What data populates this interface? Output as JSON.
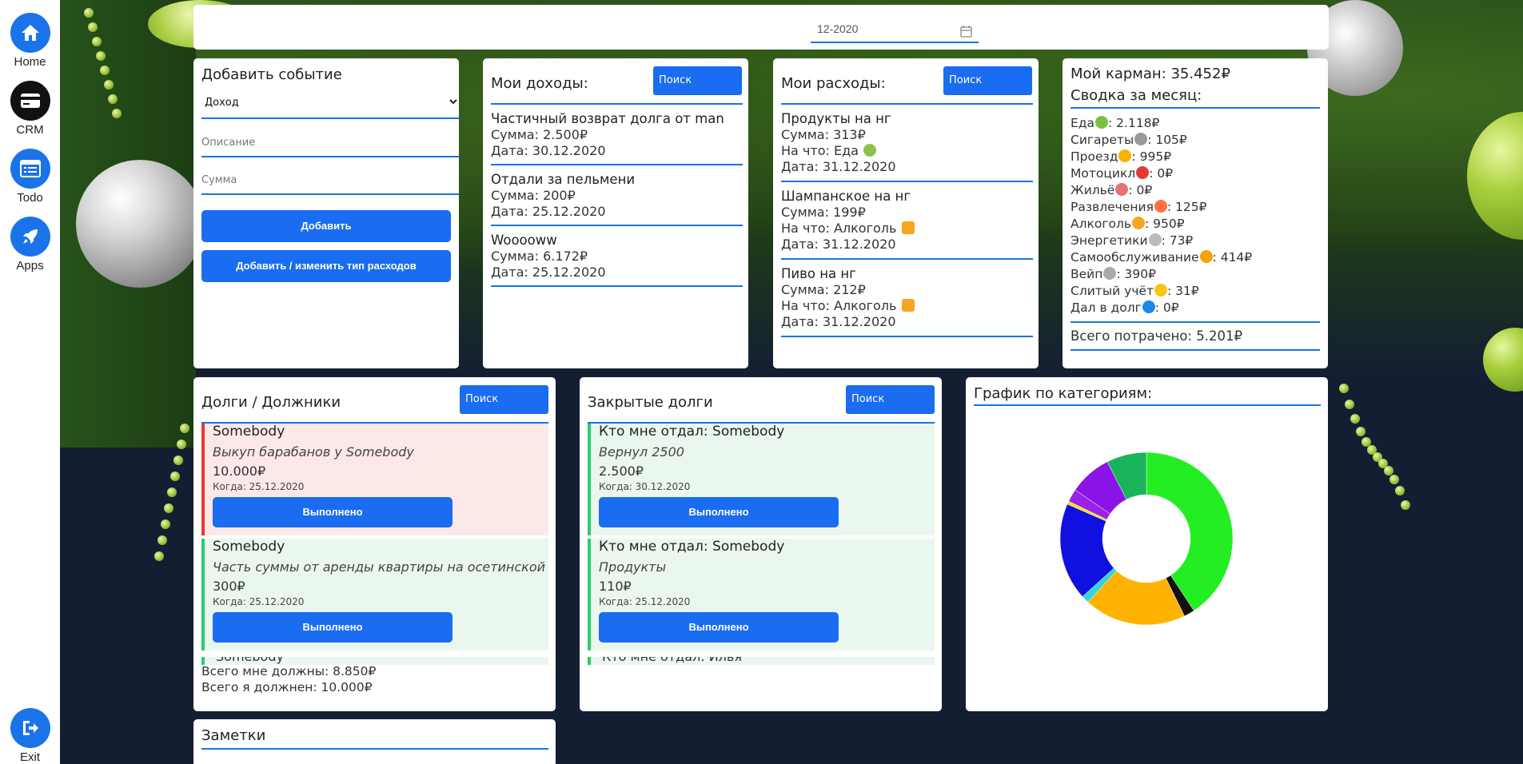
{
  "sidebar": {
    "items": [
      {
        "label": "Home",
        "icon": "home-icon"
      },
      {
        "label": "CRM",
        "icon": "card-icon"
      },
      {
        "label": "Todo",
        "icon": "list-icon"
      },
      {
        "label": "Apps",
        "icon": "rocket-icon"
      }
    ],
    "exit": {
      "label": "Exit",
      "icon": "exit-icon"
    }
  },
  "date_picker": {
    "value": "12-2020",
    "icon": "calendar-icon"
  },
  "add_event": {
    "title": "Добавить событие",
    "type_value": "Доход",
    "description_placeholder": "Описание",
    "amount_placeholder": "Сумма",
    "add_label": "Добавить",
    "edit_types_label": "Добавить / изменить тип расходов"
  },
  "income": {
    "title": "Мои доходы:",
    "search_label": "Поиск",
    "items": [
      {
        "title": "Частичный возврат долга от man",
        "sum": "Сумма: 2.500₽",
        "date": "Дата: 30.12.2020"
      },
      {
        "title": "Отдали за пельмени",
        "sum": "Сумма: 200₽",
        "date": "Дата: 25.12.2020"
      },
      {
        "title": "Wooooww",
        "sum": "Сумма: 6.172₽",
        "date": "Дата: 25.12.2020"
      }
    ]
  },
  "expenses": {
    "title": "Мои расходы:",
    "search_label": "Поиск",
    "items": [
      {
        "title": "Продукты на нг",
        "sum": "Сумма: 313₽",
        "for": "На что: Еда",
        "emoji": "apple-emoji",
        "date": "Дата: 31.12.2020"
      },
      {
        "title": "Шампанское на нг",
        "sum": "Сумма: 199₽",
        "for": "На что: Алкоголь",
        "emoji": "beer-emoji",
        "date": "Дата: 31.12.2020"
      },
      {
        "title": "Пиво на нг",
        "sum": "Сумма: 212₽",
        "for": "На что: Алкоголь",
        "emoji": "beer-emoji",
        "date": "Дата: 31.12.2020"
      }
    ]
  },
  "pocket": {
    "title": "Мой карман: 35.452₽",
    "summary_title": "Сводка за месяц:",
    "lines": [
      {
        "name": "Еда",
        "emoji_color": "#7ac142",
        "value": ": 2.118₽"
      },
      {
        "name": "Сигареты",
        "emoji_color": "#999999",
        "value": ": 105₽"
      },
      {
        "name": "Проезд",
        "emoji_color": "#f4b400",
        "value": ": 995₽"
      },
      {
        "name": "Мотоцикл",
        "emoji_color": "#e53935",
        "value": ": 0₽"
      },
      {
        "name": "Жильё",
        "emoji_color": "#e57373",
        "value": ": 0₽"
      },
      {
        "name": "Развлечения",
        "emoji_color": "#ff7043",
        "value": ": 125₽"
      },
      {
        "name": "Алкоголь",
        "emoji_color": "#f6a623",
        "value": ": 950₽"
      },
      {
        "name": "Энергетики",
        "emoji_color": "#bbbbbb",
        "value": ": 73₽"
      },
      {
        "name": "Самообслуживание",
        "emoji_color": "#f4a300",
        "value": ": 414₽"
      },
      {
        "name": "Вейп",
        "emoji_color": "#aaaaaa",
        "value": ": 390₽"
      },
      {
        "name": "Слитый учёт",
        "emoji_color": "#f9c513",
        "value": ": 31₽"
      },
      {
        "name": "Дал в долг",
        "emoji_color": "#1e88e5",
        "value": ": 0₽"
      }
    ],
    "total": "Всего потрачено: 5.201₽"
  },
  "debts": {
    "title": "Долги / Должники",
    "search_label": "Поиск",
    "items": [
      {
        "who": "Somebody",
        "desc": "Выкуп барабанов у Somebody",
        "amount": "10.000₽",
        "when": "Когда: 25.12.2020",
        "status": "red",
        "button": "Выполнено"
      },
      {
        "who": "Somebody",
        "desc": "Часть суммы от аренды квартиры на осетинской",
        "amount": "300₽",
        "when": "Когда: 25.12.2020",
        "status": "green",
        "button": "Выполнено"
      }
    ],
    "cut_item": "Somebody",
    "owed_to_me": "Всего мне должны: 8.850₽",
    "i_owe": "Всего я должнен: 10.000₽"
  },
  "closed_debts": {
    "title": "Закрытые долги",
    "search_label": "Поиск",
    "items": [
      {
        "who": "Кто мне отдал: Somebody",
        "desc": "Вернул 2500",
        "amount": "2.500₽",
        "when": "Когда: 30.12.2020",
        "button": "Выполнено"
      },
      {
        "who": "Кто мне отдал: Somebody",
        "desc": "Продукты",
        "amount": "110₽",
        "when": "Когда: 25.12.2020",
        "button": "Выполнено"
      }
    ],
    "cut_item": "Кто мне отдал: Илья"
  },
  "chart_panel": {
    "title": "График по категориям:"
  },
  "chart_data": {
    "type": "pie",
    "donut": true,
    "slices": [
      {
        "label": "Еда",
        "value": 2118,
        "color": "#22ee22"
      },
      {
        "label": "Сигареты",
        "value": 105,
        "color": "#111111"
      },
      {
        "label": "Проезд",
        "value": 995,
        "color": "#ffb300"
      },
      {
        "label": "Мотоцикл",
        "value": 0,
        "color": "#e53935"
      },
      {
        "label": "Жильё",
        "value": 0,
        "color": "#e57373"
      },
      {
        "label": "Энергетики",
        "value": 73,
        "color": "#33d6d6"
      },
      {
        "label": "Алкоголь",
        "value": 950,
        "color": "#1010e0"
      },
      {
        "label": "Слитый учёт",
        "value": 31,
        "color": "#ffe000"
      },
      {
        "label": "Развлечения",
        "value": 125,
        "color": "#9a22e8"
      },
      {
        "label": "Самообслуживание",
        "value": 414,
        "color": "#8a14e6"
      },
      {
        "label": "Вейп",
        "value": 390,
        "color": "#19b35a"
      },
      {
        "label": "Дал в долг",
        "value": 0,
        "color": "#1e88e5"
      }
    ]
  },
  "notes": {
    "title": "Заметки"
  }
}
